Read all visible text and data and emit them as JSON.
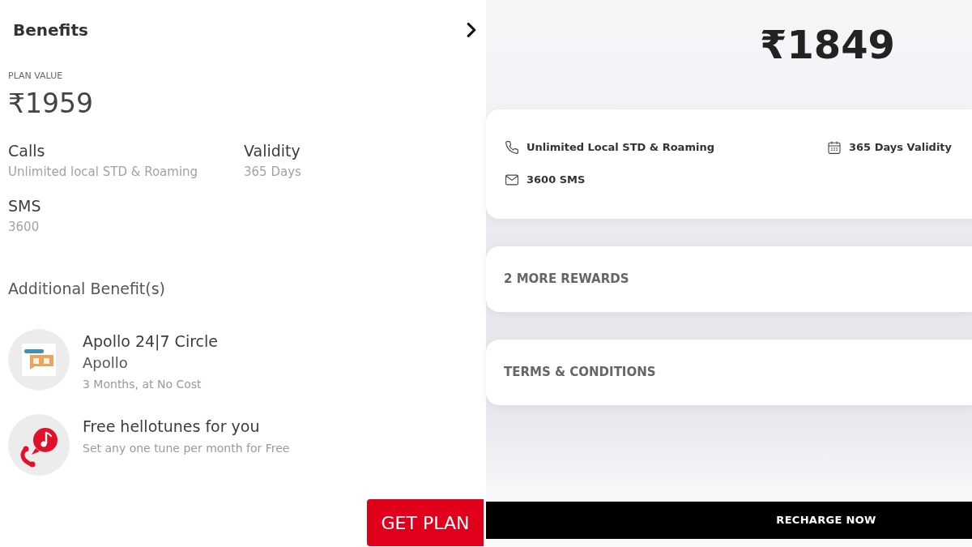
{
  "left_panel": {
    "title": "Benefits",
    "plan_value": {
      "label": "PLAN VALUE",
      "amount": "₹1959"
    },
    "features": [
      {
        "label": "Calls",
        "value": "Unlimited local STD & Roaming"
      },
      {
        "label": "Validity",
        "value": "365 Days"
      },
      {
        "label": "SMS",
        "value": "3600"
      }
    ],
    "additional_benefits": {
      "heading": "Additional Benefit(s)",
      "items": [
        {
          "kind": "logo",
          "title": "Apollo 24|7 Circle",
          "provider": "Apollo",
          "note": "3 Months, at No Cost"
        },
        {
          "kind": "tune",
          "title": "Free hellotunes for you",
          "note": "Set any one tune per month for Free"
        }
      ]
    },
    "button": "GET PLAN"
  },
  "right_panel": {
    "price": "₹1849",
    "features": [
      {
        "kind": "phone",
        "text": "Unlimited Local STD & Roaming"
      },
      {
        "kind": "calendar",
        "text": "365 Days Validity"
      },
      {
        "kind": "mail",
        "text": "3600 SMS"
      }
    ],
    "sections": [
      "2 MORE REWARDS",
      "TERMS & CONDITIONS"
    ],
    "button": "RECHARGE NOW"
  }
}
